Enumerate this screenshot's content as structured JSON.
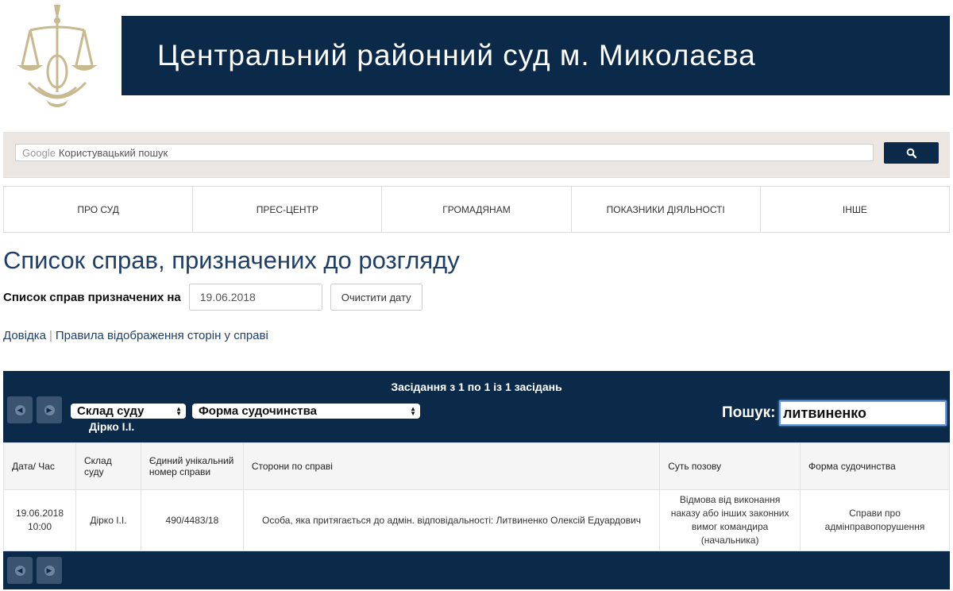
{
  "header": {
    "court_name": "Центральний районний суд м. Миколаєва"
  },
  "search": {
    "brand": "Google",
    "placeholder": "Користувацький пошук",
    "button_icon": "search-icon"
  },
  "nav": {
    "items": [
      {
        "label": "ПРО СУД"
      },
      {
        "label": "ПРЕС-ЦЕНТР"
      },
      {
        "label": "ГРОМАДЯНАМ"
      },
      {
        "label": "ПОКАЗНИКИ ДІЯЛЬНОСТІ"
      },
      {
        "label": "ІНШЕ"
      }
    ]
  },
  "page": {
    "title": "Список справ, призначених до розгляду",
    "date_label": "Список справ призначених на",
    "date_value": "19.06.2018",
    "clear_button": "Очистити дату",
    "link_help": "Довідка",
    "link_separator": "|",
    "link_rules": "Правила відображення сторін у справі"
  },
  "table": {
    "info": "Засідання з 1 по 1 із 1 засідань",
    "filter_court": "Склад суду",
    "filter_court_value": "Дірко І.І.",
    "filter_form": "Форма судочинства",
    "search_label": "Пошук:",
    "search_value": "литвиненко",
    "columns": [
      "Дата/ Час",
      "Склад суду",
      "Єдиний унікальний номер справи",
      "Сторони по справі",
      "Суть позову",
      "Форма судочинства"
    ],
    "rows": [
      {
        "date": "19.06.2018",
        "time": "10:00",
        "judge": "Дірко І.І.",
        "case_number": "490/4483/18",
        "parties": "Особа, яка притягається до адмін. відповідальності: Литвиненко Олексій Едуардович",
        "subject": "Відмова від виконання наказу або інших законних вимог командира (начальника)",
        "form": "Справи про адмінправопорушення"
      }
    ]
  },
  "colors": {
    "primary": "#0b2a4a",
    "search_band": "#ece6e3",
    "link": "#1f3f66",
    "logo_gold": "#c8b98f"
  }
}
